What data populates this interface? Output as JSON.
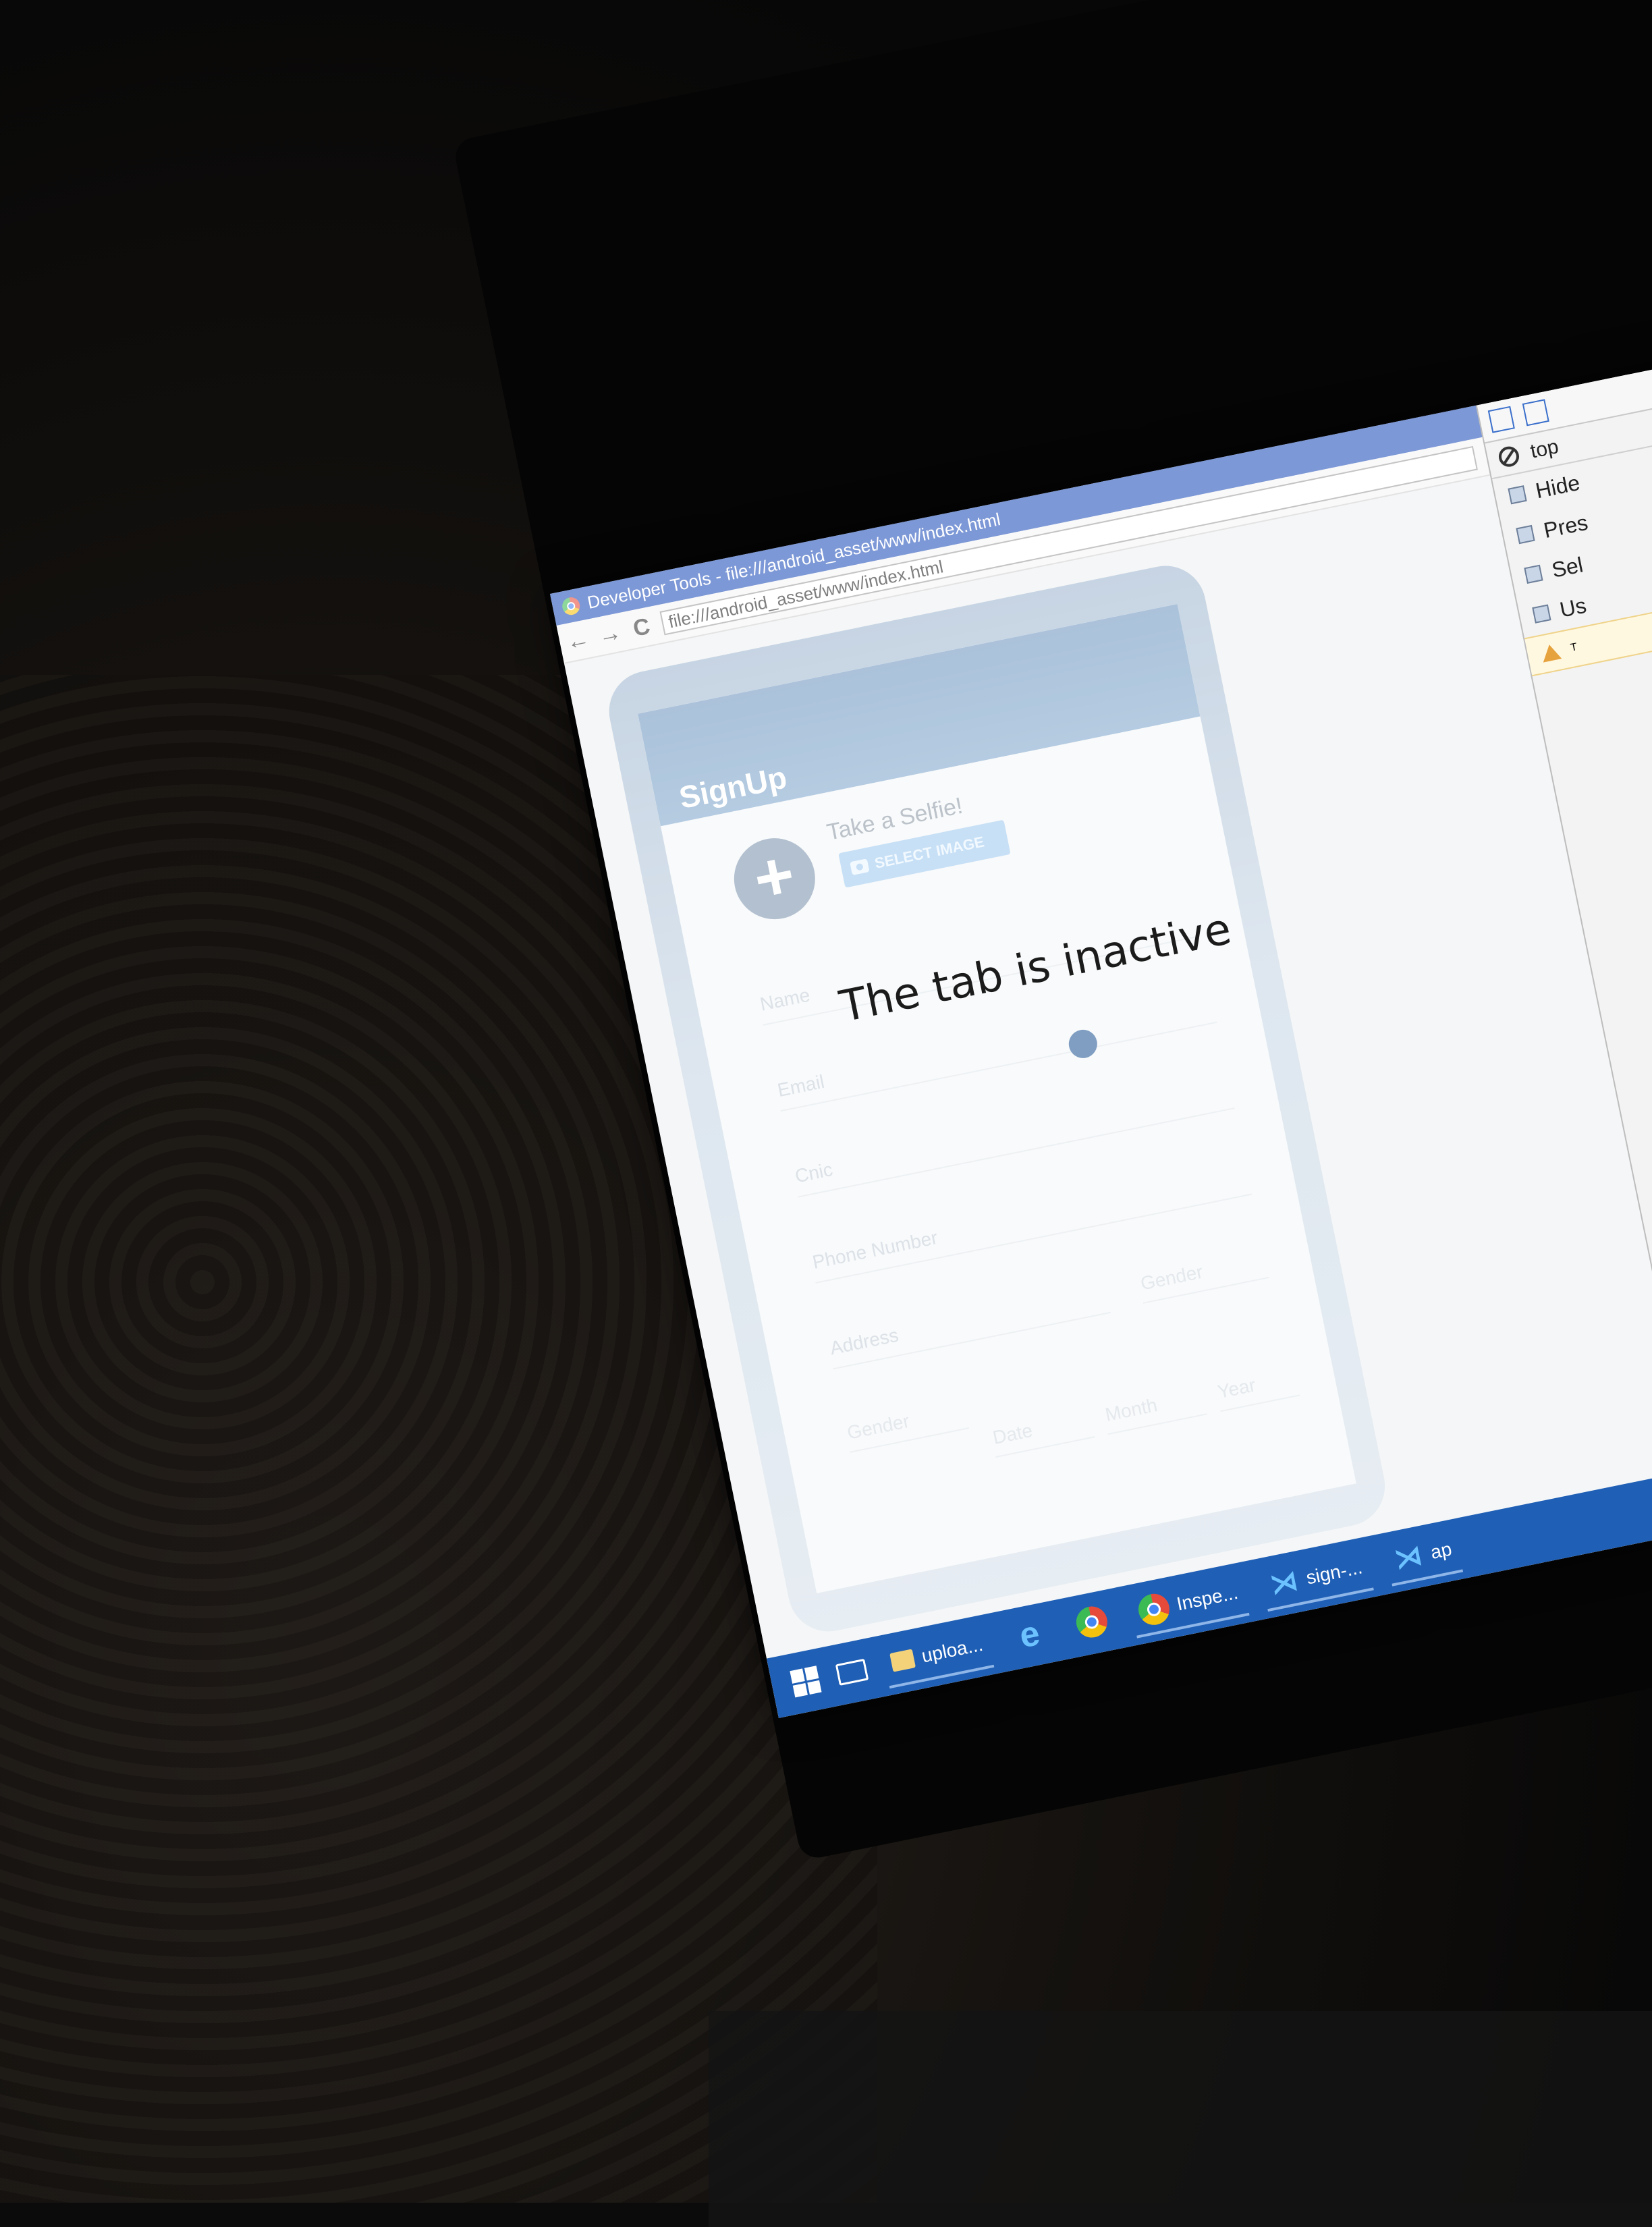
{
  "devtools": {
    "window_title": "Developer Tools - file:///android_asset/www/index.html",
    "url": "file:///android_asset/www/index.html",
    "nav": {
      "back": "←",
      "forward": "→",
      "reload": "C"
    }
  },
  "app": {
    "title": "SignUp",
    "selfie_label": "Take a Selfie!",
    "select_image_label": "SELECT IMAGE",
    "fields": {
      "name": "Name",
      "email": "Email",
      "cnic": "Cnic",
      "phone": "Phone Number",
      "address": "Address",
      "gender": "Gender",
      "dob_label": "Gender",
      "date": "Date",
      "month": "Month",
      "year": "Year"
    }
  },
  "overlay": {
    "message": "The tab is inactive"
  },
  "panel": {
    "context": "top",
    "options": [
      "Hide",
      "Pres",
      "Sel",
      "Us"
    ],
    "warning": "T"
  },
  "taskbar": {
    "items": [
      {
        "label": "uploa...",
        "icon": "folder-icon"
      },
      {
        "label": "",
        "icon": "edge-icon"
      },
      {
        "label": "",
        "icon": "chrome-icon"
      },
      {
        "label": "Inspe...",
        "icon": "chrome-icon"
      },
      {
        "label": "sign-...",
        "icon": "vscode-icon"
      },
      {
        "label": "ap",
        "icon": "vscode-icon"
      }
    ]
  }
}
